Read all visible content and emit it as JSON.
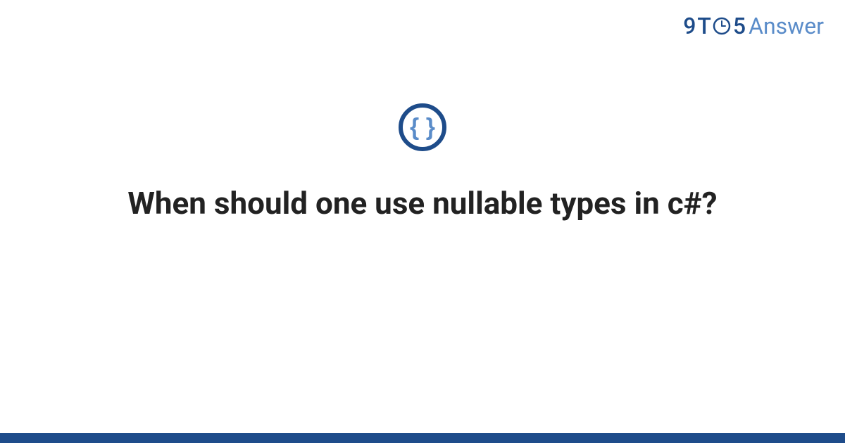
{
  "brand": {
    "nine": "9",
    "t": "T",
    "five": "5",
    "answer": "Answer"
  },
  "question": {
    "title": "When should one use nullable types in c#?"
  },
  "colors": {
    "brand_dark": "#1e4c8a",
    "brand_light": "#5a8cc9",
    "text": "#222222",
    "footer_bar": "#1e4c8a"
  }
}
